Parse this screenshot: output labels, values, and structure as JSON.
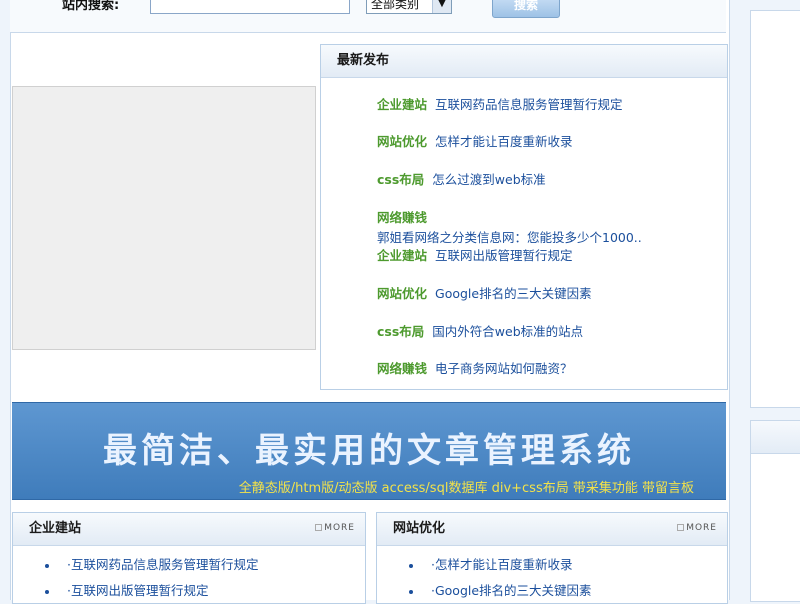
{
  "search": {
    "label": "站内搜索:",
    "input_value": "",
    "select_value": "全部类别",
    "button_label": "搜索"
  },
  "latest": {
    "header": "最新发布",
    "items": [
      {
        "category": "企业建站",
        "title": "互联网药品信息服务管理暂行规定"
      },
      {
        "category": "网站优化",
        "title": "怎样才能让百度重新收录"
      },
      {
        "category": "css布局",
        "title": "怎么过渡到web标准"
      },
      {
        "category": "网络赚钱",
        "title": "郭姐看网络之分类信息网：您能投多少个1000.."
      },
      {
        "category": "企业建站",
        "title": "互联网出版管理暂行规定"
      },
      {
        "category": "网站优化",
        "title": "Google排名的三大关键因素"
      },
      {
        "category": "css布局",
        "title": "国内外符合web标准的站点"
      },
      {
        "category": "网络赚钱",
        "title": "电子商务网站如何融资？"
      }
    ]
  },
  "banner": {
    "slogan": "最简洁、最实用的文章管理系统",
    "features": "全静态版/htm版/动态版  access/sql数据库  div+css布局  带采集功能  带留言板"
  },
  "panels": {
    "left": {
      "header": "企业建站",
      "more": "MORE",
      "items": [
        "·互联网药品信息服务管理暂行规定",
        "·互联网出版管理暂行规定"
      ]
    },
    "right": {
      "header": "网站优化",
      "more": "MORE",
      "items": [
        "·怎样才能让百度重新收录",
        "·Google排名的三大关键因素"
      ]
    }
  },
  "colors": {
    "category_green": "#4d9a2e",
    "link_blue": "#1b4f9c",
    "banner_blue": "#4a88c7",
    "banner_text_yellow": "#f3e24a"
  }
}
